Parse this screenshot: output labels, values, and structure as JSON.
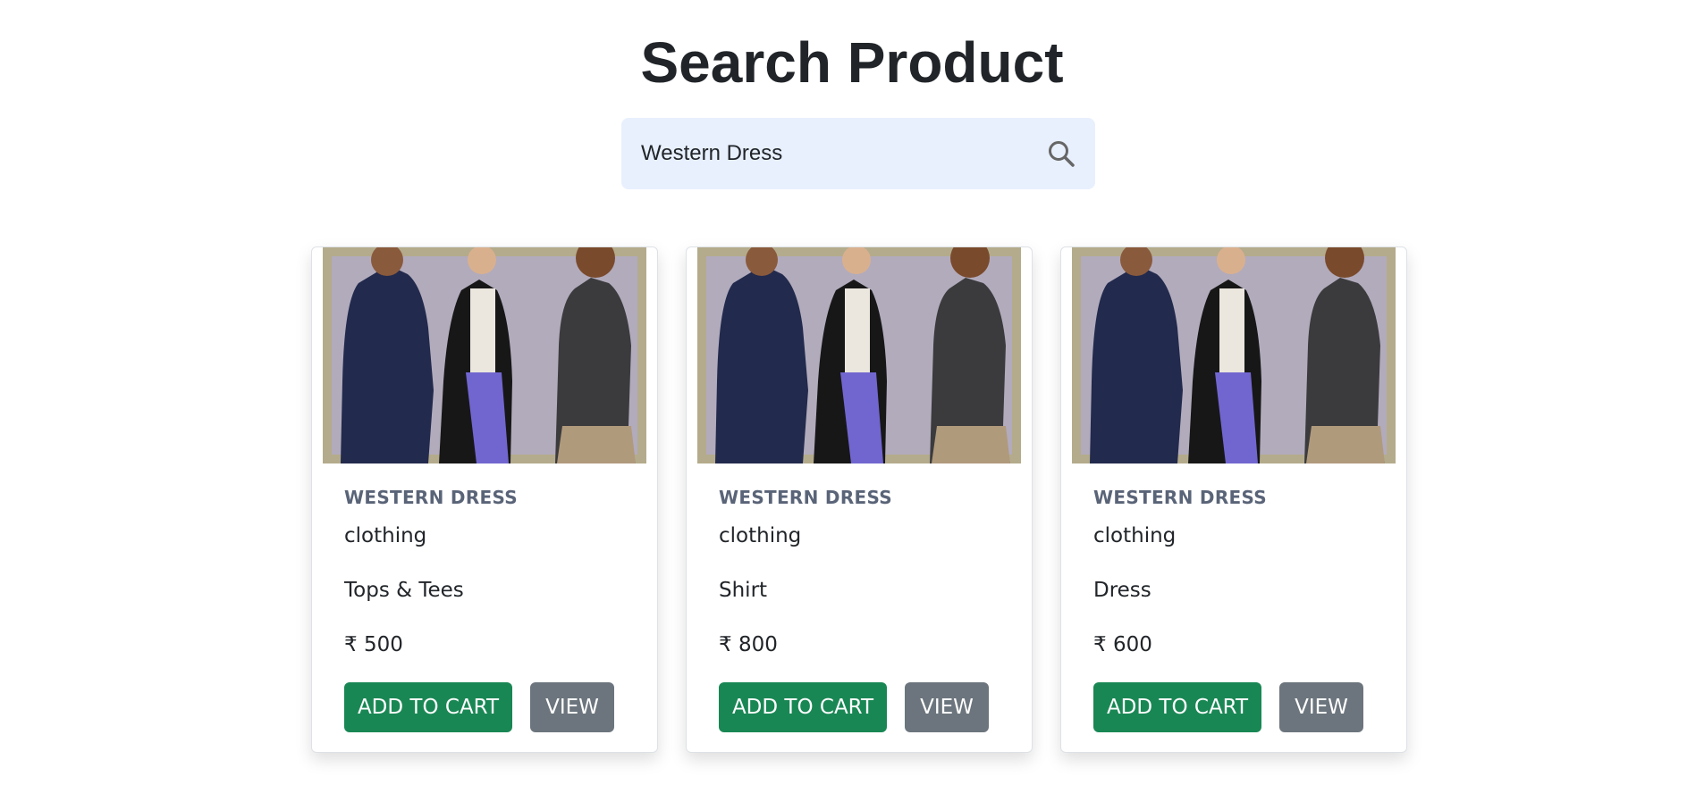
{
  "page": {
    "title": "Search Product"
  },
  "search": {
    "value": "Western Dress",
    "icon": "search-icon"
  },
  "products": [
    {
      "title": "WESTERN DRESS",
      "category": "clothing",
      "subcategory": "Tops & Tees",
      "price": "₹ 500",
      "add_to_cart_label": "ADD TO CART",
      "view_label": "VIEW"
    },
    {
      "title": "WESTERN DRESS",
      "category": "clothing",
      "subcategory": "Shirt",
      "price": "₹ 800",
      "add_to_cart_label": "ADD TO CART",
      "view_label": "VIEW"
    },
    {
      "title": "WESTERN DRESS",
      "category": "clothing",
      "subcategory": "Dress",
      "price": "₹ 600",
      "add_to_cart_label": "ADD TO CART",
      "view_label": "VIEW"
    }
  ],
  "colors": {
    "add_to_cart": "#198754",
    "view": "#6c757d",
    "search_bg": "#e8f0fe",
    "title_text": "#5a6478"
  }
}
